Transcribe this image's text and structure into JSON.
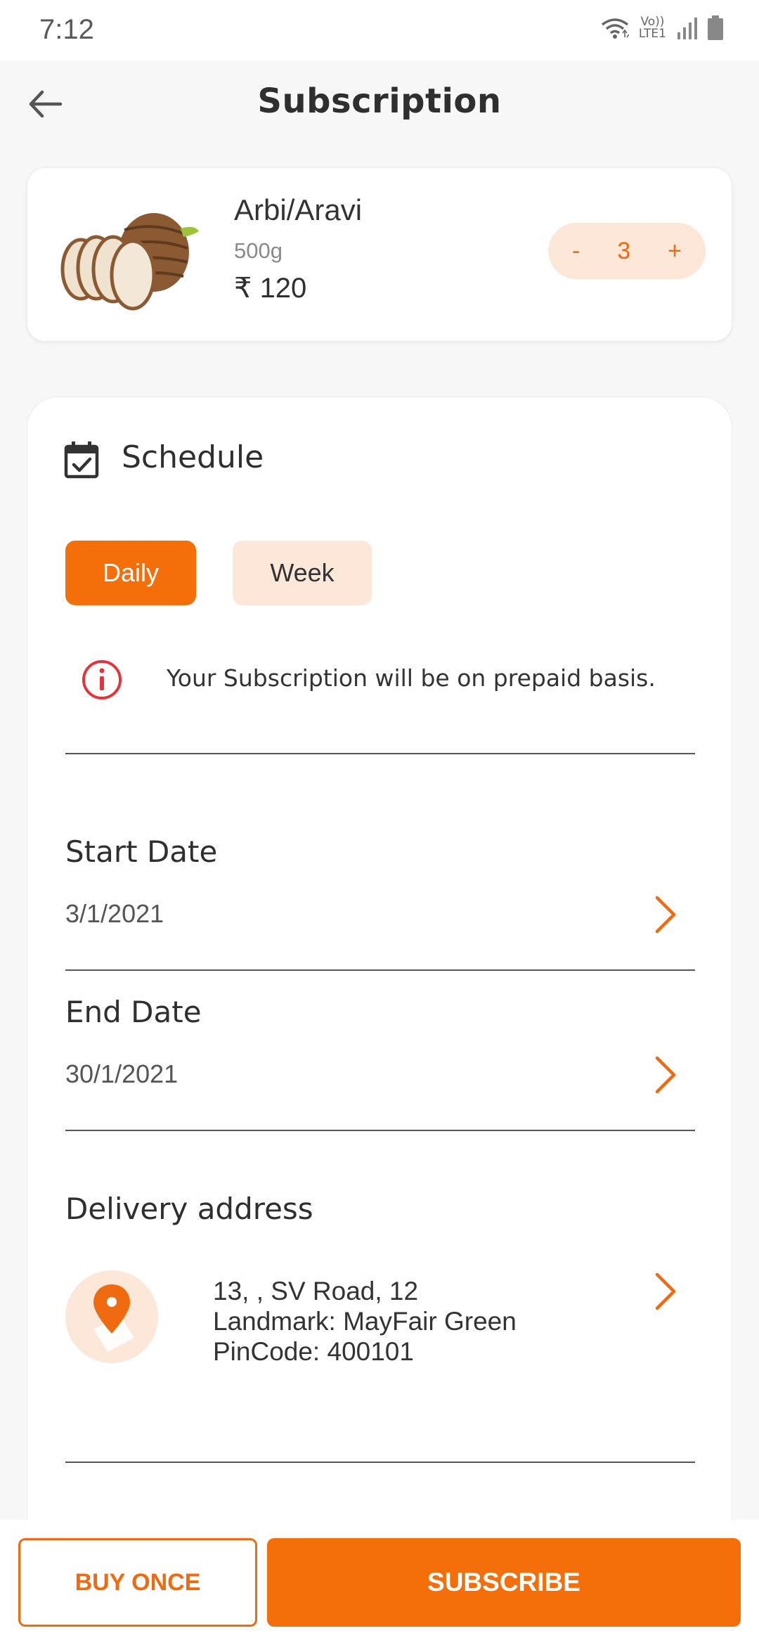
{
  "status_bar": {
    "time": "7:12",
    "network_label": "Vo)) LTE1"
  },
  "header": {
    "title": "Subscription"
  },
  "product": {
    "name": "Arbi/Aravi",
    "weight": "500g",
    "price": "₹ 120",
    "quantity": "3",
    "minus_label": "-",
    "plus_label": "+"
  },
  "schedule": {
    "title": "Schedule",
    "options": [
      "Daily",
      "Week"
    ],
    "selected": "Daily",
    "info_text": "Your Subscription will be on prepaid basis."
  },
  "start_date": {
    "label": "Start Date",
    "value": "3/1/2021"
  },
  "end_date": {
    "label": "End Date",
    "value": "30/1/2021"
  },
  "delivery": {
    "label": "Delivery address",
    "lines": [
      "13, , SV Road, 12",
      "Landmark: MayFair Green",
      "PinCode: 400101"
    ]
  },
  "actions": {
    "buy_once": "BUY ONCE",
    "subscribe": "SUBSCRIBE"
  },
  "colors": {
    "accent": "#f46f0a",
    "accent_light": "#fde7d8",
    "info_red": "#e5333a",
    "background": "#f7f7f7"
  },
  "icons": [
    "wifi-icon",
    "signal-icon",
    "battery-icon",
    "back-arrow-icon",
    "calendar-check-icon",
    "info-icon",
    "chevron-right-icon",
    "location-pin-icon"
  ]
}
